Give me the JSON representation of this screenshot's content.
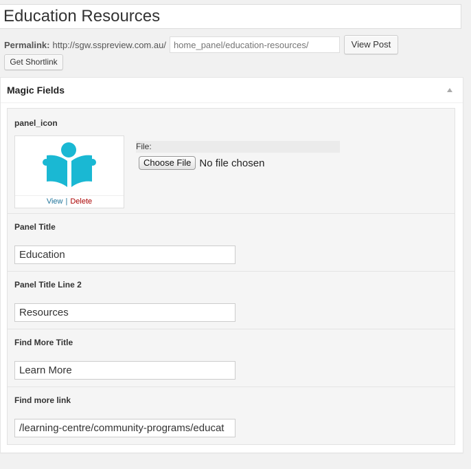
{
  "post": {
    "title": "Education Resources",
    "permalink_label": "Permalink:",
    "permalink_base": "http://sgw.sspreview.com.au/",
    "slug_placeholder": "home_panel/education-resources/",
    "view_post_label": "View Post",
    "shortlink_label": "Get Shortlink"
  },
  "metabox": {
    "title": "Magic Fields",
    "toggle_icon": "triangle-up-icon",
    "fields": {
      "panel_icon": {
        "label": "panel_icon",
        "view_label": "View",
        "separator": "|",
        "delete_label": "Delete",
        "file_label": "File:",
        "choose_label": "Choose File",
        "no_file_text": "No file chosen",
        "icon": "open-book-reader-icon",
        "icon_color": "#1ab8d3"
      },
      "panel_title": {
        "label": "Panel Title",
        "value": "Education"
      },
      "panel_title_line2": {
        "label": "Panel Title Line 2",
        "value": "Resources"
      },
      "find_more_title": {
        "label": "Find More Title",
        "value": "Learn More"
      },
      "find_more_link": {
        "label": "Find more link",
        "value": "/learning-centre/community-programs/educat"
      }
    }
  }
}
